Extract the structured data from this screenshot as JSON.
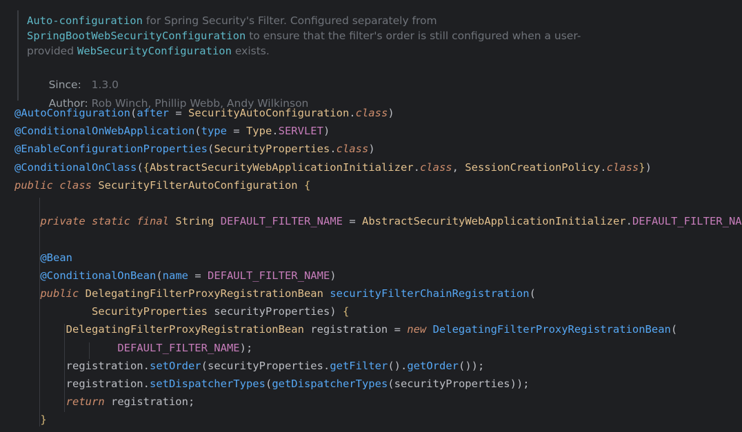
{
  "colors": {
    "background": "#1e1f22",
    "plain": "#bcbec4",
    "annotation": "#56a8f5",
    "keyword": "#cf8e6d",
    "class_name": "#e2c08d",
    "constant": "#c77dbb",
    "field": "#c77dbb",
    "method": "#56a8f5",
    "brace": "#d5b778",
    "parameter": "#bcbec4",
    "doc_text": "#6f737a",
    "doc_code": "#5fb8c7",
    "indent_guide": "#393b40"
  },
  "javadoc": {
    "lines": [
      [
        {
          "t": "Auto-configuration",
          "k": "code"
        },
        {
          "t": " for Spring Security's Filter. Configured separately from",
          "k": "text"
        }
      ],
      [
        {
          "t": "SpringBootWebSecurityConfiguration",
          "k": "code"
        },
        {
          "t": " to ensure that the filter's order is still configured when a user-",
          "k": "text"
        }
      ],
      [
        {
          "t": "provided ",
          "k": "text"
        },
        {
          "t": "WebSecurityConfiguration",
          "k": "code"
        },
        {
          "t": " exists.",
          "k": "text"
        }
      ]
    ],
    "since_label": "Since:",
    "since_value": "1.3.0",
    "author_label": "Author:",
    "author_value": "Rob Winch, Phillip Webb, Andy Wilkinson"
  },
  "code_lines": [
    [
      {
        "t": "@AutoConfiguration",
        "c": "#56a8f5"
      },
      {
        "t": "(",
        "c": "#bcbec4"
      },
      {
        "t": "after",
        "c": "#56a8f5"
      },
      {
        "t": " = ",
        "c": "#bcbec4"
      },
      {
        "t": "SecurityAutoConfiguration",
        "c": "#e2c08d"
      },
      {
        "t": ".",
        "c": "#bcbec4"
      },
      {
        "t": "class",
        "c": "#cf8e6d",
        "i": true
      },
      {
        "t": ")",
        "c": "#bcbec4"
      }
    ],
    [
      {
        "t": "@ConditionalOnWebApplication",
        "c": "#56a8f5"
      },
      {
        "t": "(",
        "c": "#bcbec4"
      },
      {
        "t": "type",
        "c": "#56a8f5"
      },
      {
        "t": " = ",
        "c": "#bcbec4"
      },
      {
        "t": "Type",
        "c": "#e2c08d"
      },
      {
        "t": ".",
        "c": "#bcbec4"
      },
      {
        "t": "SERVLET",
        "c": "#c77dbb"
      },
      {
        "t": ")",
        "c": "#bcbec4"
      }
    ],
    [
      {
        "t": "@EnableConfigurationProperties",
        "c": "#56a8f5"
      },
      {
        "t": "(",
        "c": "#bcbec4"
      },
      {
        "t": "SecurityProperties",
        "c": "#e2c08d"
      },
      {
        "t": ".",
        "c": "#bcbec4"
      },
      {
        "t": "class",
        "c": "#cf8e6d",
        "i": true
      },
      {
        "t": ")",
        "c": "#bcbec4"
      }
    ],
    [
      {
        "t": "@ConditionalOnClass",
        "c": "#56a8f5"
      },
      {
        "t": "(",
        "c": "#bcbec4"
      },
      {
        "t": "{",
        "c": "#d5b778"
      },
      {
        "t": "AbstractSecurityWebApplicationInitializer",
        "c": "#e2c08d"
      },
      {
        "t": ".",
        "c": "#bcbec4"
      },
      {
        "t": "class",
        "c": "#cf8e6d",
        "i": true
      },
      {
        "t": ", ",
        "c": "#bcbec4"
      },
      {
        "t": "SessionCreationPolicy",
        "c": "#e2c08d"
      },
      {
        "t": ".",
        "c": "#bcbec4"
      },
      {
        "t": "class",
        "c": "#cf8e6d",
        "i": true
      },
      {
        "t": "}",
        "c": "#d5b778"
      },
      {
        "t": ")",
        "c": "#bcbec4"
      }
    ],
    [
      {
        "t": "public",
        "c": "#cf8e6d",
        "i": true
      },
      {
        "t": " ",
        "c": "#bcbec4"
      },
      {
        "t": "class",
        "c": "#cf8e6d",
        "i": true
      },
      {
        "t": " SecurityFilterAutoConfiguration ",
        "c": "#e2c08d"
      },
      {
        "t": "{",
        "c": "#d5b778"
      }
    ],
    [],
    [
      {
        "t": "    ",
        "c": "#bcbec4"
      },
      {
        "t": "private",
        "c": "#cf8e6d",
        "i": true
      },
      {
        "t": " ",
        "c": "#bcbec4"
      },
      {
        "t": "static",
        "c": "#cf8e6d",
        "i": true
      },
      {
        "t": " ",
        "c": "#bcbec4"
      },
      {
        "t": "final",
        "c": "#cf8e6d",
        "i": true
      },
      {
        "t": " ",
        "c": "#bcbec4"
      },
      {
        "t": "String",
        "c": "#e2c08d"
      },
      {
        "t": " ",
        "c": "#bcbec4"
      },
      {
        "t": "DEFAULT_FILTER_NAME",
        "c": "#c77dbb"
      },
      {
        "t": " = ",
        "c": "#bcbec4"
      },
      {
        "t": "AbstractSecurityWebApplicationInitializer",
        "c": "#e2c08d"
      },
      {
        "t": ".",
        "c": "#bcbec4"
      },
      {
        "t": "DEFAULT_FILTER_NAME",
        "c": "#c77dbb"
      },
      {
        "t": ";",
        "c": "#bcbec4"
      }
    ],
    [],
    [
      {
        "t": "    ",
        "c": "#bcbec4"
      },
      {
        "t": "@Bean",
        "c": "#56a8f5"
      }
    ],
    [
      {
        "t": "    ",
        "c": "#bcbec4"
      },
      {
        "t": "@ConditionalOnBean",
        "c": "#56a8f5"
      },
      {
        "t": "(",
        "c": "#bcbec4"
      },
      {
        "t": "name",
        "c": "#56a8f5"
      },
      {
        "t": " = ",
        "c": "#bcbec4"
      },
      {
        "t": "DEFAULT_FILTER_NAME",
        "c": "#c77dbb"
      },
      {
        "t": ")",
        "c": "#bcbec4"
      }
    ],
    [
      {
        "t": "    ",
        "c": "#bcbec4"
      },
      {
        "t": "public",
        "c": "#cf8e6d",
        "i": true
      },
      {
        "t": " ",
        "c": "#bcbec4"
      },
      {
        "t": "DelegatingFilterProxyRegistrationBean",
        "c": "#e2c08d"
      },
      {
        "t": " ",
        "c": "#bcbec4"
      },
      {
        "t": "securityFilterChainRegistration",
        "c": "#56a8f5"
      },
      {
        "t": "(",
        "c": "#bcbec4"
      }
    ],
    [
      {
        "t": "            ",
        "c": "#bcbec4"
      },
      {
        "t": "SecurityProperties",
        "c": "#e2c08d"
      },
      {
        "t": " securityProperties",
        "c": "#bcbec4"
      },
      {
        "t": ") ",
        "c": "#bcbec4"
      },
      {
        "t": "{",
        "c": "#d5b778"
      }
    ],
    [
      {
        "t": "        ",
        "c": "#bcbec4"
      },
      {
        "t": "DelegatingFilterProxyRegistrationBean",
        "c": "#e2c08d"
      },
      {
        "t": " registration = ",
        "c": "#bcbec4"
      },
      {
        "t": "new",
        "c": "#cf8e6d",
        "i": true
      },
      {
        "t": " ",
        "c": "#bcbec4"
      },
      {
        "t": "DelegatingFilterProxyRegistrationBean",
        "c": "#56a8f5"
      },
      {
        "t": "(",
        "c": "#bcbec4"
      }
    ],
    [
      {
        "t": "                ",
        "c": "#bcbec4"
      },
      {
        "t": "DEFAULT_FILTER_NAME",
        "c": "#c77dbb"
      },
      {
        "t": ");",
        "c": "#bcbec4"
      }
    ],
    [
      {
        "t": "        ",
        "c": "#bcbec4"
      },
      {
        "t": "registration",
        "c": "#bcbec4"
      },
      {
        "t": ".",
        "c": "#bcbec4"
      },
      {
        "t": "setOrder",
        "c": "#56a8f5"
      },
      {
        "t": "(",
        "c": "#bcbec4"
      },
      {
        "t": "securityProperties",
        "c": "#bcbec4"
      },
      {
        "t": ".",
        "c": "#bcbec4"
      },
      {
        "t": "getFilter",
        "c": "#56a8f5"
      },
      {
        "t": "()",
        "c": "#bcbec4"
      },
      {
        "t": ".",
        "c": "#bcbec4"
      },
      {
        "t": "getOrder",
        "c": "#56a8f5"
      },
      {
        "t": "());",
        "c": "#bcbec4"
      }
    ],
    [
      {
        "t": "        ",
        "c": "#bcbec4"
      },
      {
        "t": "registration",
        "c": "#bcbec4"
      },
      {
        "t": ".",
        "c": "#bcbec4"
      },
      {
        "t": "setDispatcherTypes",
        "c": "#56a8f5"
      },
      {
        "t": "(",
        "c": "#bcbec4"
      },
      {
        "t": "getDispatcherTypes",
        "c": "#56a8f5"
      },
      {
        "t": "(",
        "c": "#bcbec4"
      },
      {
        "t": "securityProperties",
        "c": "#bcbec4"
      },
      {
        "t": "));",
        "c": "#bcbec4"
      }
    ],
    [
      {
        "t": "        ",
        "c": "#bcbec4"
      },
      {
        "t": "return",
        "c": "#cf8e6d",
        "i": true
      },
      {
        "t": " registration;",
        "c": "#bcbec4"
      }
    ],
    [
      {
        "t": "    ",
        "c": "#bcbec4"
      },
      {
        "t": "}",
        "c": "#d5b778"
      }
    ]
  ]
}
